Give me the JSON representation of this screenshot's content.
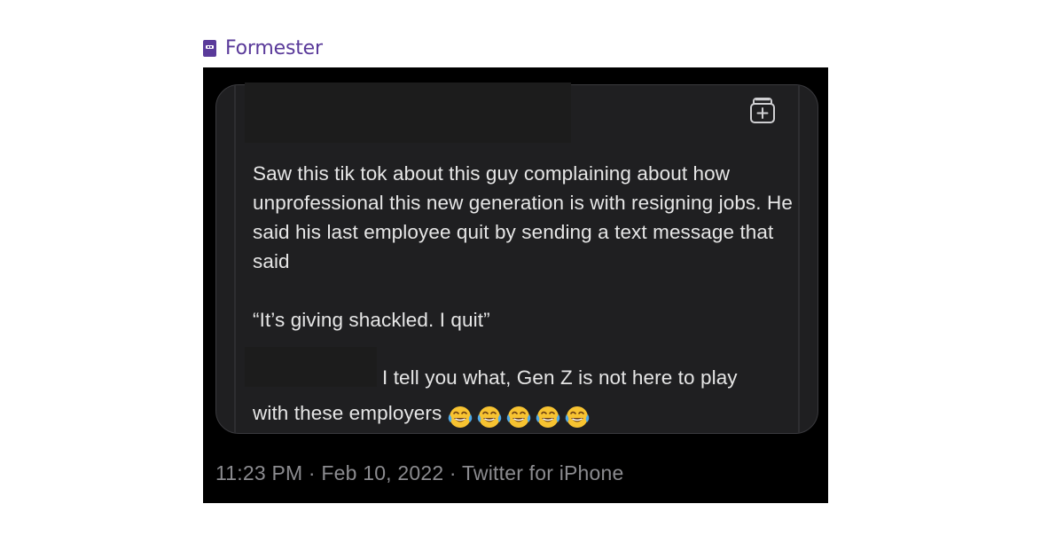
{
  "brand": {
    "name": "Formester"
  },
  "post": {
    "paragraph1": "Saw this tik tok about this guy complaining about how unprofessional this new generation is with resigning jobs. He said his last employee quit by sending a text message that said",
    "quote": "“It’s giving shackled. I quit”",
    "paragraph3_line1": "I tell you what, Gen Z is not here to play",
    "paragraph3_line2": "with these employers",
    "emojis": [
      "face-with-tears-of-joy",
      "face-with-tears-of-joy",
      "face-with-tears-of-joy",
      "face-with-tears-of-joy",
      "face-with-tears-of-joy"
    ]
  },
  "meta": {
    "line": "11:23 PM · Feb 10, 2022 · Twitter for iPhone"
  },
  "icons": {
    "save": "bookmark-add-icon",
    "brand": "formester-logo-icon"
  },
  "colors": {
    "brand": "#5a3a9a",
    "background": "#000000",
    "card": "#1f1f21",
    "text": "#e6e6e6",
    "meta_text": "#8b8b8f"
  }
}
